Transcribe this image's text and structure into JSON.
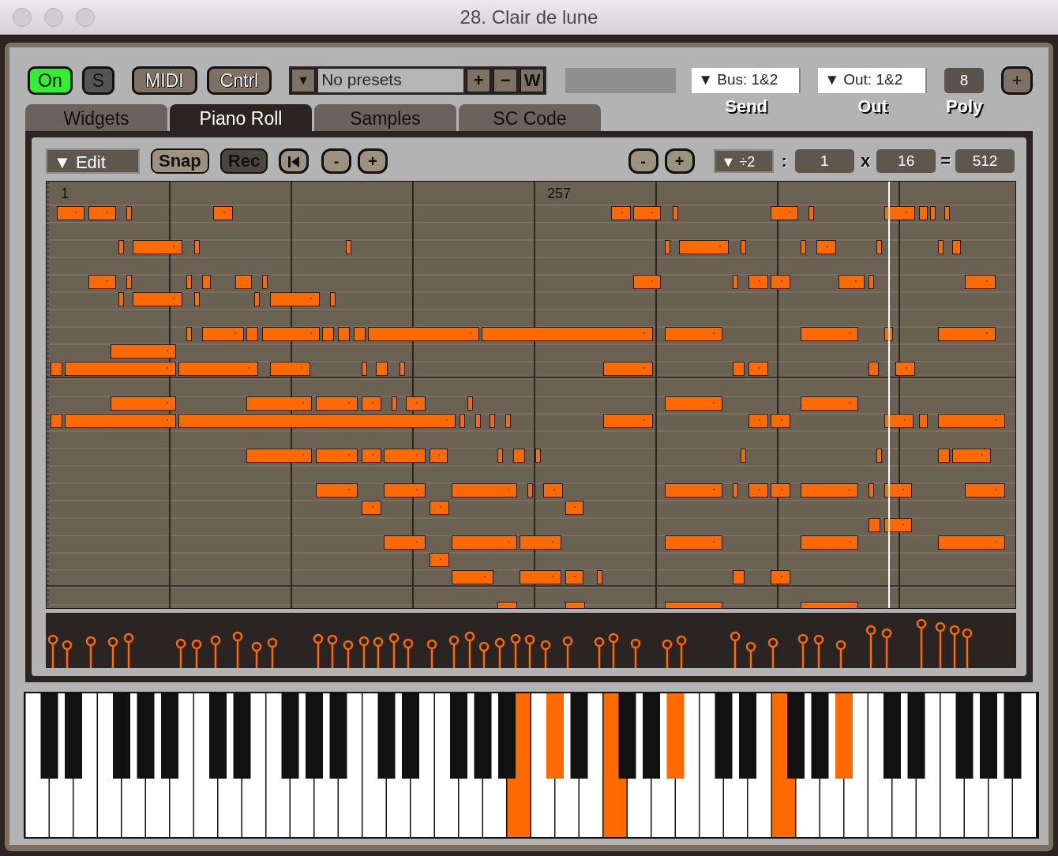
{
  "window": {
    "title": "28. Clair de lune"
  },
  "top_bar": {
    "on_button": {
      "label": "On",
      "on": true
    },
    "solo_button": {
      "label": "S",
      "on": false
    },
    "midi_button": {
      "label": "MIDI"
    },
    "control_button": {
      "label": "Cntrl"
    },
    "presets": {
      "arrow": "▼",
      "value": "No presets",
      "buttons": [
        "+",
        "−",
        "W"
      ]
    },
    "send": {
      "value": "▼  Bus: 1&2",
      "label": "Send"
    },
    "out": {
      "value": "▼  Out: 1&2",
      "label": "Out"
    },
    "poly": {
      "value": "8",
      "label": "Poly"
    },
    "add_button": "+"
  },
  "tabs": [
    {
      "label": "Widgets",
      "selected": false
    },
    {
      "label": "Piano Roll",
      "selected": true
    },
    {
      "label": "Samples",
      "selected": false
    },
    {
      "label": "SC Code",
      "selected": false
    }
  ],
  "toolbar": {
    "mode_menu": "▼   Edit",
    "snap": {
      "label": "Snap",
      "on": false
    },
    "rec": {
      "label": "Rec",
      "on": true
    },
    "zoom_buttons": [
      "-",
      "+"
    ],
    "grid_buttons": [
      "-",
      "+"
    ],
    "division_menu": "▼  ÷2",
    "colon": ":",
    "beats": "1",
    "times": "x",
    "steps": "16",
    "equals": "=",
    "total": "512"
  },
  "ruler": [
    {
      "label": "1"
    },
    {
      "label": "257"
    }
  ],
  "keyboard": {
    "white_keys": [
      {
        "pressed": false
      },
      {
        "pressed": false
      },
      {
        "pressed": false
      },
      {
        "pressed": false
      },
      {
        "pressed": false
      },
      {
        "pressed": false
      },
      {
        "pressed": false
      },
      {
        "pressed": false
      },
      {
        "pressed": false
      },
      {
        "pressed": false
      },
      {
        "pressed": false
      },
      {
        "pressed": false
      },
      {
        "pressed": false
      },
      {
        "pressed": false
      },
      {
        "pressed": false
      },
      {
        "pressed": false
      },
      {
        "pressed": false
      },
      {
        "pressed": false
      },
      {
        "pressed": false
      },
      {
        "pressed": false
      },
      {
        "pressed": true
      },
      {
        "pressed": false
      },
      {
        "pressed": false
      },
      {
        "pressed": false
      },
      {
        "pressed": true
      },
      {
        "pressed": false
      },
      {
        "pressed": false
      },
      {
        "pressed": false
      },
      {
        "pressed": false
      },
      {
        "pressed": false
      },
      {
        "pressed": false
      },
      {
        "pressed": true
      },
      {
        "pressed": false
      },
      {
        "pressed": false
      },
      {
        "pressed": false
      },
      {
        "pressed": false
      },
      {
        "pressed": false
      },
      {
        "pressed": false
      },
      {
        "pressed": false
      },
      {
        "pressed": false
      },
      {
        "pressed": false
      },
      {
        "pressed": false
      }
    ],
    "black_keys": [
      {
        "pressed": false
      },
      {
        "pressed": false
      },
      {
        "pressed": false
      },
      {
        "pressed": false
      },
      {
        "pressed": false
      },
      {
        "pressed": false
      },
      {
        "pressed": false
      },
      {
        "pressed": false
      },
      {
        "pressed": false
      },
      {
        "pressed": false
      },
      {
        "pressed": false
      },
      {
        "pressed": false
      },
      {
        "pressed": false
      },
      {
        "pressed": false
      },
      {
        "pressed": false
      },
      {
        "pressed": true
      },
      {
        "pressed": false
      },
      {
        "pressed": false
      },
      {
        "pressed": false
      },
      {
        "pressed": true
      },
      {
        "pressed": false
      },
      {
        "pressed": false
      },
      {
        "pressed": false
      },
      {
        "pressed": false
      },
      {
        "pressed": true
      },
      {
        "pressed": false
      },
      {
        "pressed": false
      },
      {
        "pressed": false
      },
      {
        "pressed": false
      },
      {
        "pressed": false
      }
    ]
  }
}
